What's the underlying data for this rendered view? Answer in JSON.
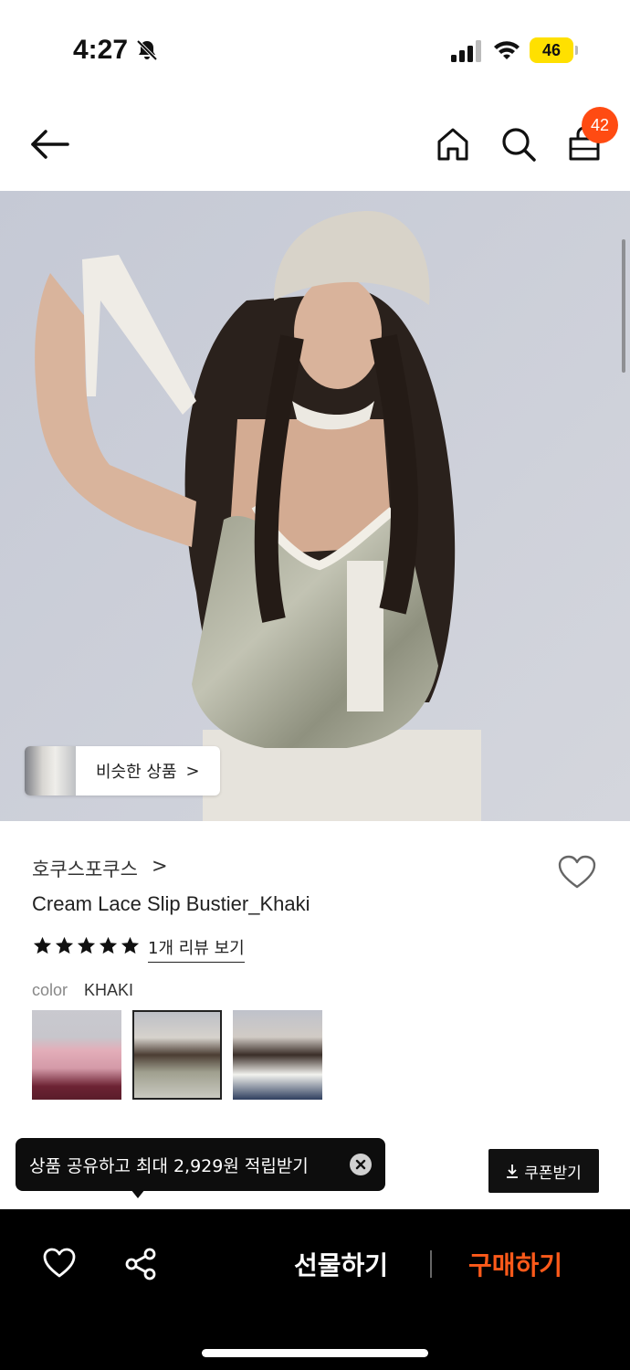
{
  "status_bar": {
    "time": "4:27",
    "battery": "46"
  },
  "header": {
    "cart_count": "42"
  },
  "hero": {
    "similar_label": "비슷한 상품",
    "similar_arrow": ">"
  },
  "product": {
    "brand": "호쿠스포쿠스",
    "brand_chevron": ">",
    "name": "Cream Lace Slip Bustier_Khaki",
    "rating_stars": 5,
    "review_link": "1개 리뷰 보기",
    "color_label": "color",
    "color_value": "KHAKI",
    "swatches": [
      "pink",
      "khaki",
      "white"
    ],
    "selected_swatch": "khaki"
  },
  "toast": {
    "text": "상품 공유하고 최대 2,929원 적립받기"
  },
  "coupon": {
    "label": "쿠폰받기"
  },
  "bottom_bar": {
    "gift_label": "선물하기",
    "buy_label": "구매하기",
    "buy_color": "#ff5a1a"
  },
  "icons": {
    "back": "arrow-left-icon",
    "home": "home-icon",
    "search": "search-icon",
    "cart": "shopping-bag-icon",
    "like": "heart-icon",
    "share": "share-icon",
    "download": "download-icon",
    "close": "close-icon"
  }
}
